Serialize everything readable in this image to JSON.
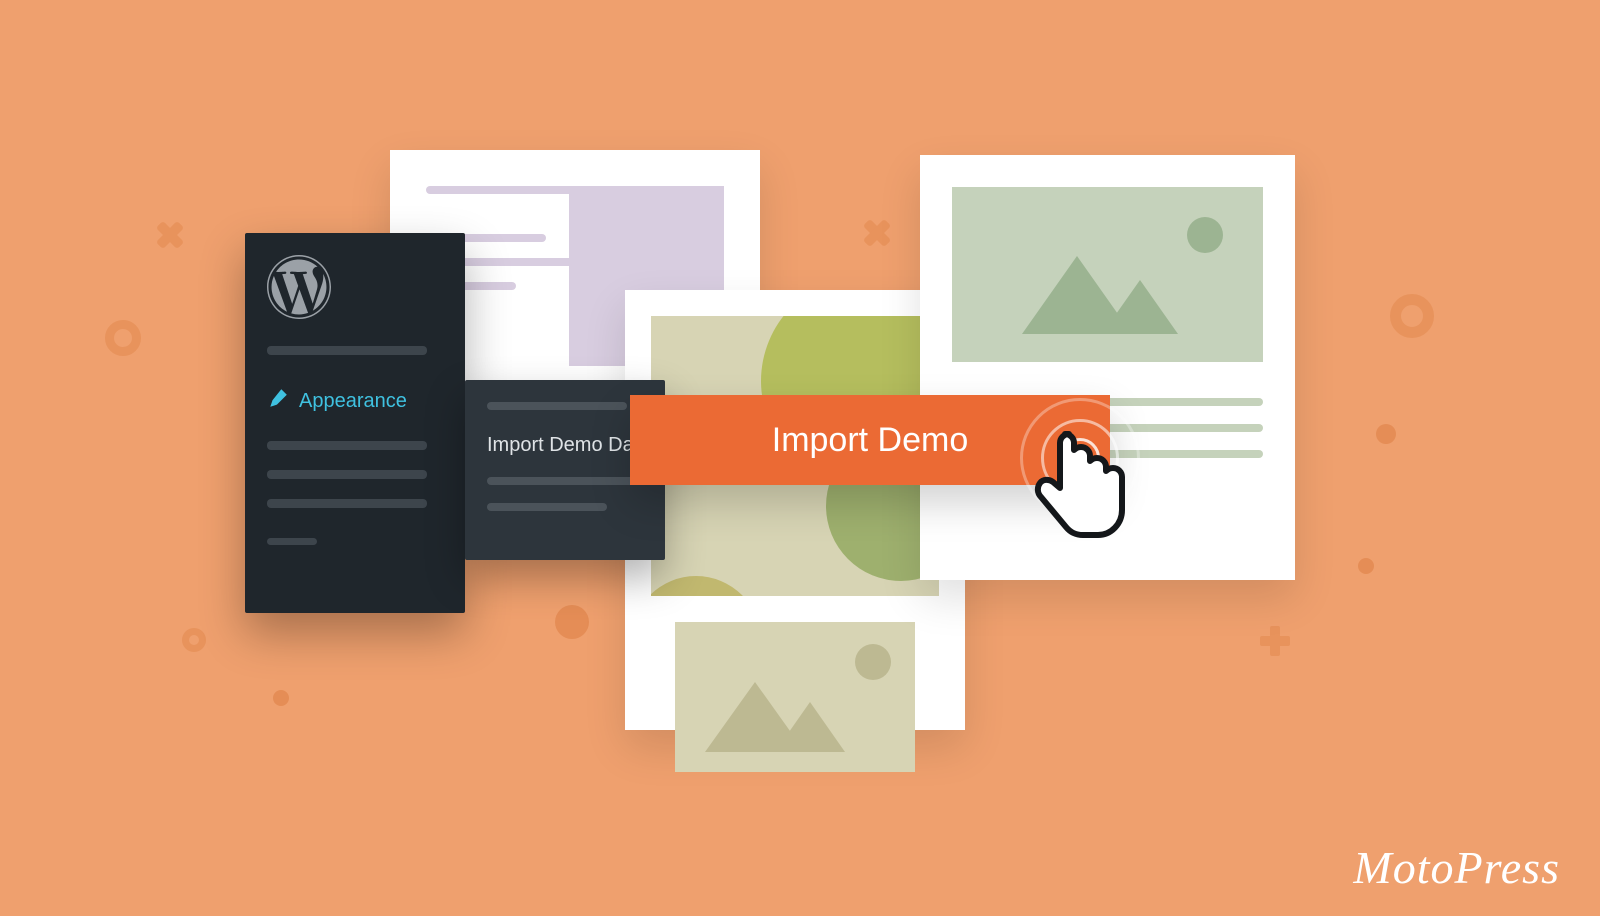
{
  "wp_sidebar": {
    "appearance_label": "Appearance"
  },
  "wp_flyout": {
    "import_label": "Import Demo Data"
  },
  "cta": {
    "import_button": "Import Demo"
  },
  "brand": {
    "name": "MotoPress"
  }
}
